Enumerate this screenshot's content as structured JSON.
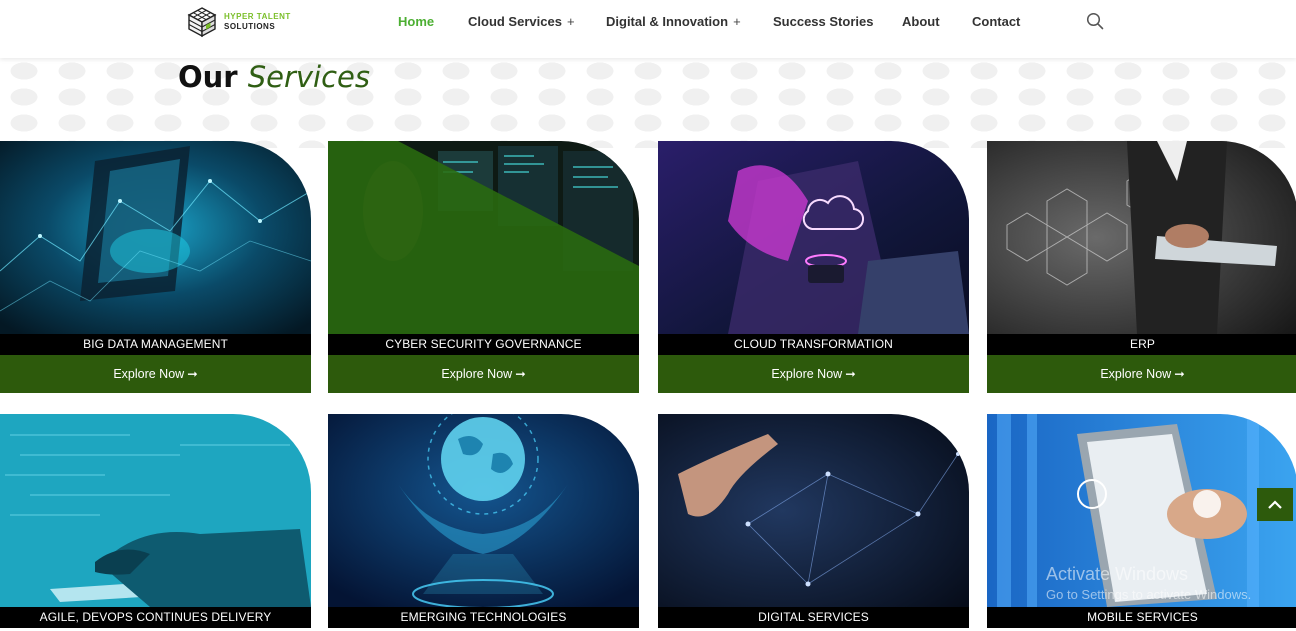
{
  "header": {
    "logo": {
      "line1": "HYPER TALENT",
      "line2": "SOLUTIONS"
    },
    "nav": [
      {
        "label": "Home",
        "active": true
      },
      {
        "label": "Cloud Services",
        "has_submenu": true
      },
      {
        "label": "Digital & Innovation",
        "has_submenu": true
      },
      {
        "label": "Success Stories"
      },
      {
        "label": "About"
      },
      {
        "label": "Contact"
      }
    ],
    "submenu_symbol": "+",
    "search_icon": "search-icon"
  },
  "section": {
    "title_plain": "Our",
    "title_accent": "Services"
  },
  "cards": [
    {
      "title": "BIG DATA MANAGEMENT",
      "button": "Explore Now",
      "arrow": "➞"
    },
    {
      "title": "CYBER SECURITY GOVERNANCE",
      "button": "Explore Now",
      "arrow": "➞"
    },
    {
      "title": "CLOUD TRANSFORMATION",
      "button": "Explore Now",
      "arrow": "➞"
    },
    {
      "title": "ERP",
      "button": "Explore Now",
      "arrow": "➞"
    },
    {
      "title": "AGILE, DEVOPS CONTINUES DELIVERY"
    },
    {
      "title": "EMERGING TECHNOLOGIES"
    },
    {
      "title": "DIGITAL SERVICES"
    },
    {
      "title": "MOBILE SERVICES"
    }
  ],
  "scroll_top_icon": "chevron-up-icon",
  "watermark": {
    "line1": "Activate Windows",
    "line2": "Go to Settings to activate Windows."
  },
  "colors": {
    "brand_green": "#2d5a0c",
    "nav_active": "#4caf32",
    "caption_bg": "#000000"
  }
}
